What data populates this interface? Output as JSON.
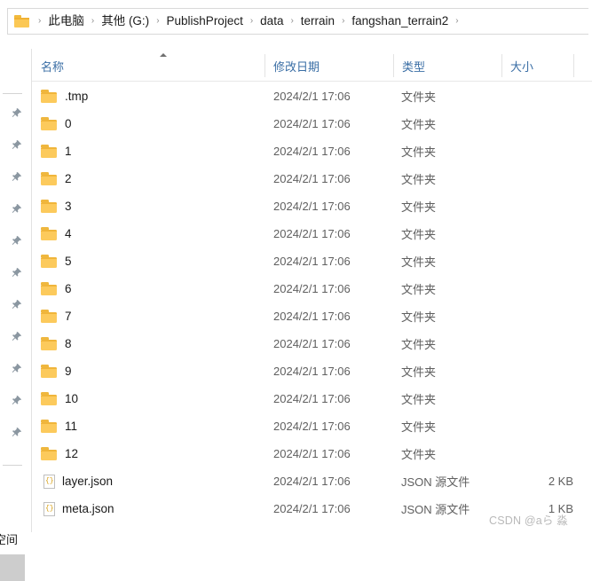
{
  "window": {
    "type": "file-explorer"
  },
  "addressbar": {
    "folder_icon": "folder-icon",
    "separator": "›",
    "crumbs": [
      {
        "label": "此电脑"
      },
      {
        "label": "其他 (G:)"
      },
      {
        "label": "PublishProject"
      },
      {
        "label": "data"
      },
      {
        "label": "terrain"
      },
      {
        "label": "fangshan_terrain2"
      }
    ]
  },
  "sidebar": {
    "pin_icon": "pin-icon",
    "pin_count": 11,
    "bottom_label": "空间"
  },
  "columns": {
    "name": "名称",
    "date_modified": "修改日期",
    "type": "类型",
    "size": "大小",
    "sort_column": "名称",
    "sort_direction": "ascending"
  },
  "files": [
    {
      "name": ".tmp",
      "icon": "folder-icon",
      "date": "2024/2/1 17:06",
      "type": "文件夹",
      "size": ""
    },
    {
      "name": "0",
      "icon": "folder-icon",
      "date": "2024/2/1 17:06",
      "type": "文件夹",
      "size": ""
    },
    {
      "name": "1",
      "icon": "folder-icon",
      "date": "2024/2/1 17:06",
      "type": "文件夹",
      "size": ""
    },
    {
      "name": "2",
      "icon": "folder-icon",
      "date": "2024/2/1 17:06",
      "type": "文件夹",
      "size": ""
    },
    {
      "name": "3",
      "icon": "folder-icon",
      "date": "2024/2/1 17:06",
      "type": "文件夹",
      "size": ""
    },
    {
      "name": "4",
      "icon": "folder-icon",
      "date": "2024/2/1 17:06",
      "type": "文件夹",
      "size": ""
    },
    {
      "name": "5",
      "icon": "folder-icon",
      "date": "2024/2/1 17:06",
      "type": "文件夹",
      "size": ""
    },
    {
      "name": "6",
      "icon": "folder-icon",
      "date": "2024/2/1 17:06",
      "type": "文件夹",
      "size": ""
    },
    {
      "name": "7",
      "icon": "folder-icon",
      "date": "2024/2/1 17:06",
      "type": "文件夹",
      "size": ""
    },
    {
      "name": "8",
      "icon": "folder-icon",
      "date": "2024/2/1 17:06",
      "type": "文件夹",
      "size": ""
    },
    {
      "name": "9",
      "icon": "folder-icon",
      "date": "2024/2/1 17:06",
      "type": "文件夹",
      "size": ""
    },
    {
      "name": "10",
      "icon": "folder-icon",
      "date": "2024/2/1 17:06",
      "type": "文件夹",
      "size": ""
    },
    {
      "name": "11",
      "icon": "folder-icon",
      "date": "2024/2/1 17:06",
      "type": "文件夹",
      "size": ""
    },
    {
      "name": "12",
      "icon": "folder-icon",
      "date": "2024/2/1 17:06",
      "type": "文件夹",
      "size": ""
    },
    {
      "name": "layer.json",
      "icon": "json-file-icon",
      "date": "2024/2/1 17:06",
      "type": "JSON 源文件",
      "size": "2 KB"
    },
    {
      "name": "meta.json",
      "icon": "json-file-icon",
      "date": "2024/2/1 17:06",
      "type": "JSON 源文件",
      "size": "1 KB"
    }
  ],
  "watermark": {
    "text": "CSDN @aら  淼"
  },
  "colors": {
    "header_text": "#3a6ea5",
    "folder_fill": "#fcca5c",
    "row_text": "#1a1a1a",
    "secondary_text": "#5f5f5f",
    "watermark": "#b9b9b9"
  }
}
